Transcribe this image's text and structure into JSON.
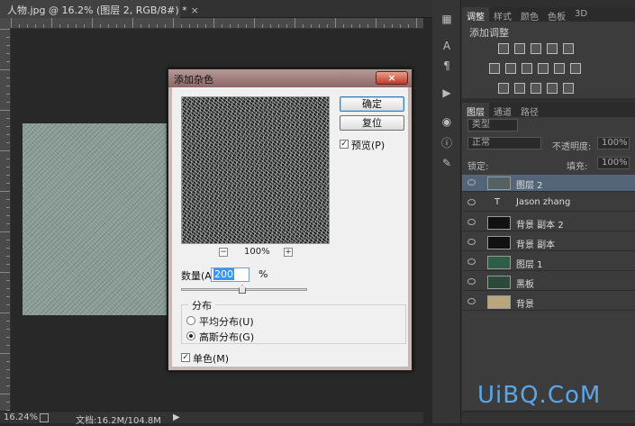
{
  "document": {
    "tab_title": "人物.jpg @ 16.2% (图层 2, RGB/8#) *",
    "close": "×"
  },
  "status": {
    "zoom": "16.24%",
    "doc_info": "文档:16.2M/104.8M"
  },
  "dialog": {
    "title": "添加杂色",
    "close_label": "×",
    "ok_label": "确定",
    "reset_label": "复位",
    "preview_label": "预览(P)",
    "preview_checked": true,
    "zoom_minus": "−",
    "zoom_level": "100%",
    "zoom_plus": "+",
    "amount_label": "数量(A):",
    "amount_value": "200",
    "amount_unit": "%",
    "distribution_legend": "分布",
    "uniform_label": "平均分布(U)",
    "gaussian_label": "高斯分布(G)",
    "gaussian_selected": true,
    "mono_label": "单色(M)",
    "mono_checked": true
  },
  "adjustments_panel": {
    "tabs": [
      "调整",
      "样式",
      "颜色",
      "色板",
      "3D"
    ],
    "title": "添加调整"
  },
  "layers_panel": {
    "tabs": [
      "图层",
      "通道",
      "路径"
    ],
    "filter_kind": "类型",
    "blend_mode": "正常",
    "opacity_label": "不透明度:",
    "opacity_value": "100%",
    "lock_label": "锁定:",
    "fill_label": "填充:",
    "fill_value": "100%",
    "layers": [
      {
        "name": "图层 2",
        "selected": true,
        "thumb": "#556060"
      },
      {
        "name": "Jason zhang",
        "selected": false,
        "type": "text"
      },
      {
        "name": "背景 副本 2",
        "selected": false,
        "thumb": "#111111"
      },
      {
        "name": "背景 副本",
        "selected": false,
        "thumb": "#111111"
      },
      {
        "name": "图层 1",
        "selected": false,
        "thumb": "#2f5e48"
      },
      {
        "name": "黑板",
        "selected": false,
        "thumb": "#2b4a3a"
      },
      {
        "name": "背景",
        "selected": false,
        "thumb": "#b9a67a"
      }
    ]
  },
  "watermark": "UiBQ.CoM"
}
